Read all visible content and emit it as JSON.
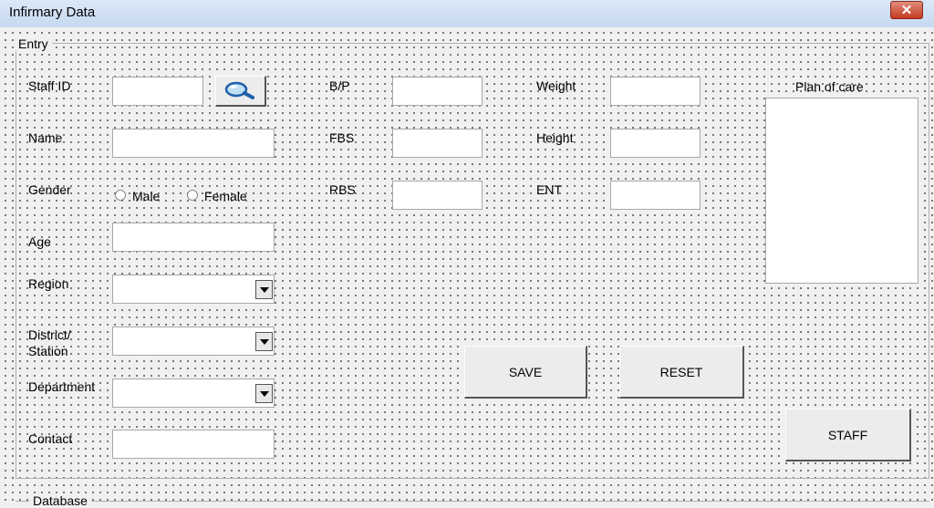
{
  "window": {
    "title": "Infirmary Data",
    "close_glyph": "✕"
  },
  "entry_group": {
    "caption": "Entry"
  },
  "database_group": {
    "caption": "Database"
  },
  "staff_id": {
    "label": "Staff ID",
    "value": "",
    "search_icon": "magnifier-icon"
  },
  "name": {
    "label": "Name",
    "value": ""
  },
  "gender": {
    "label": "Gender",
    "options": [
      "Male",
      "Female"
    ],
    "selected": null
  },
  "age": {
    "label": "Age",
    "value": ""
  },
  "region": {
    "label": "Region",
    "value": ""
  },
  "district": {
    "label_line1": "District/",
    "label_line2": "Station",
    "value": ""
  },
  "department": {
    "label": "Department",
    "value": ""
  },
  "contact": {
    "label": "Contact",
    "value": ""
  },
  "bp": {
    "label": "B/P",
    "value": ""
  },
  "fbs": {
    "label": "FBS",
    "value": ""
  },
  "rbs": {
    "label": "RBS",
    "value": ""
  },
  "weight": {
    "label": "Weight",
    "value": ""
  },
  "height": {
    "label": "Height",
    "value": ""
  },
  "ent": {
    "label": "ENT",
    "value": ""
  },
  "plan_of_care": {
    "label": "Plan of care",
    "value": ""
  },
  "buttons": {
    "save": "SAVE",
    "reset": "RESET",
    "staff": "STAFF"
  }
}
